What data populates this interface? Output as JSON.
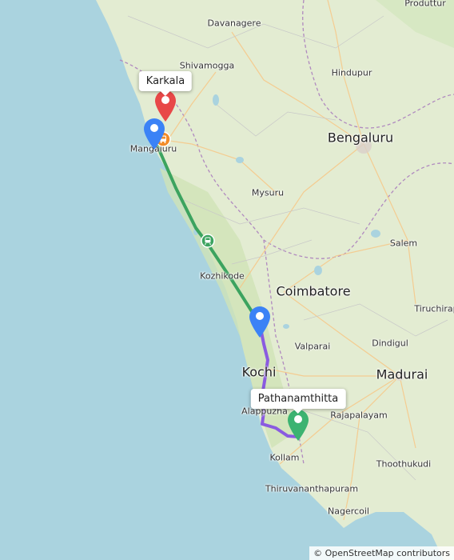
{
  "map": {
    "colors": {
      "sea": "#aad3df",
      "land": "#e3ecd2",
      "route_green": "#3ca35f",
      "route_purple": "#8a5be0",
      "pin_red": "#e84848",
      "pin_blue": "#3b82f6",
      "pin_green": "#3cb371"
    },
    "labels": {
      "produttur": "Produttur",
      "davanagere": "Davanagere",
      "shivamogga": "Shivamogga",
      "hindupur": "Hindupur",
      "bengaluru": "Bengaluru",
      "mangaluru": "Mangaluru",
      "mysuru": "Mysuru",
      "salem": "Salem",
      "kozhikode": "Kozhikode",
      "coimbatore": "Coimbatore",
      "tiruchirappalli": "Tiruchirap",
      "valparai": "Valparai",
      "dindigul": "Dindigul",
      "kochi": "Kochi",
      "madurai": "Madurai",
      "alappuzha": "Alappuzha",
      "rajapalayam": "Rajapalayam",
      "kollam": "Kollam",
      "thoothukudi": "Thoothukudi",
      "thiruvananthapuram": "Thiruvananthapuram",
      "nagercoil": "Nagercoil"
    },
    "tooltips": {
      "origin": "Karkala",
      "destination": "Pathanamthitta"
    },
    "pins": {
      "origin": "map-marker-red",
      "stop_1": "map-marker-blue",
      "stop_2": "map-marker-blue",
      "destination": "map-marker-green"
    },
    "icons": {
      "bus": "bus-icon",
      "train": "train-icon"
    },
    "attribution": "© OpenStreetMap contributors"
  }
}
